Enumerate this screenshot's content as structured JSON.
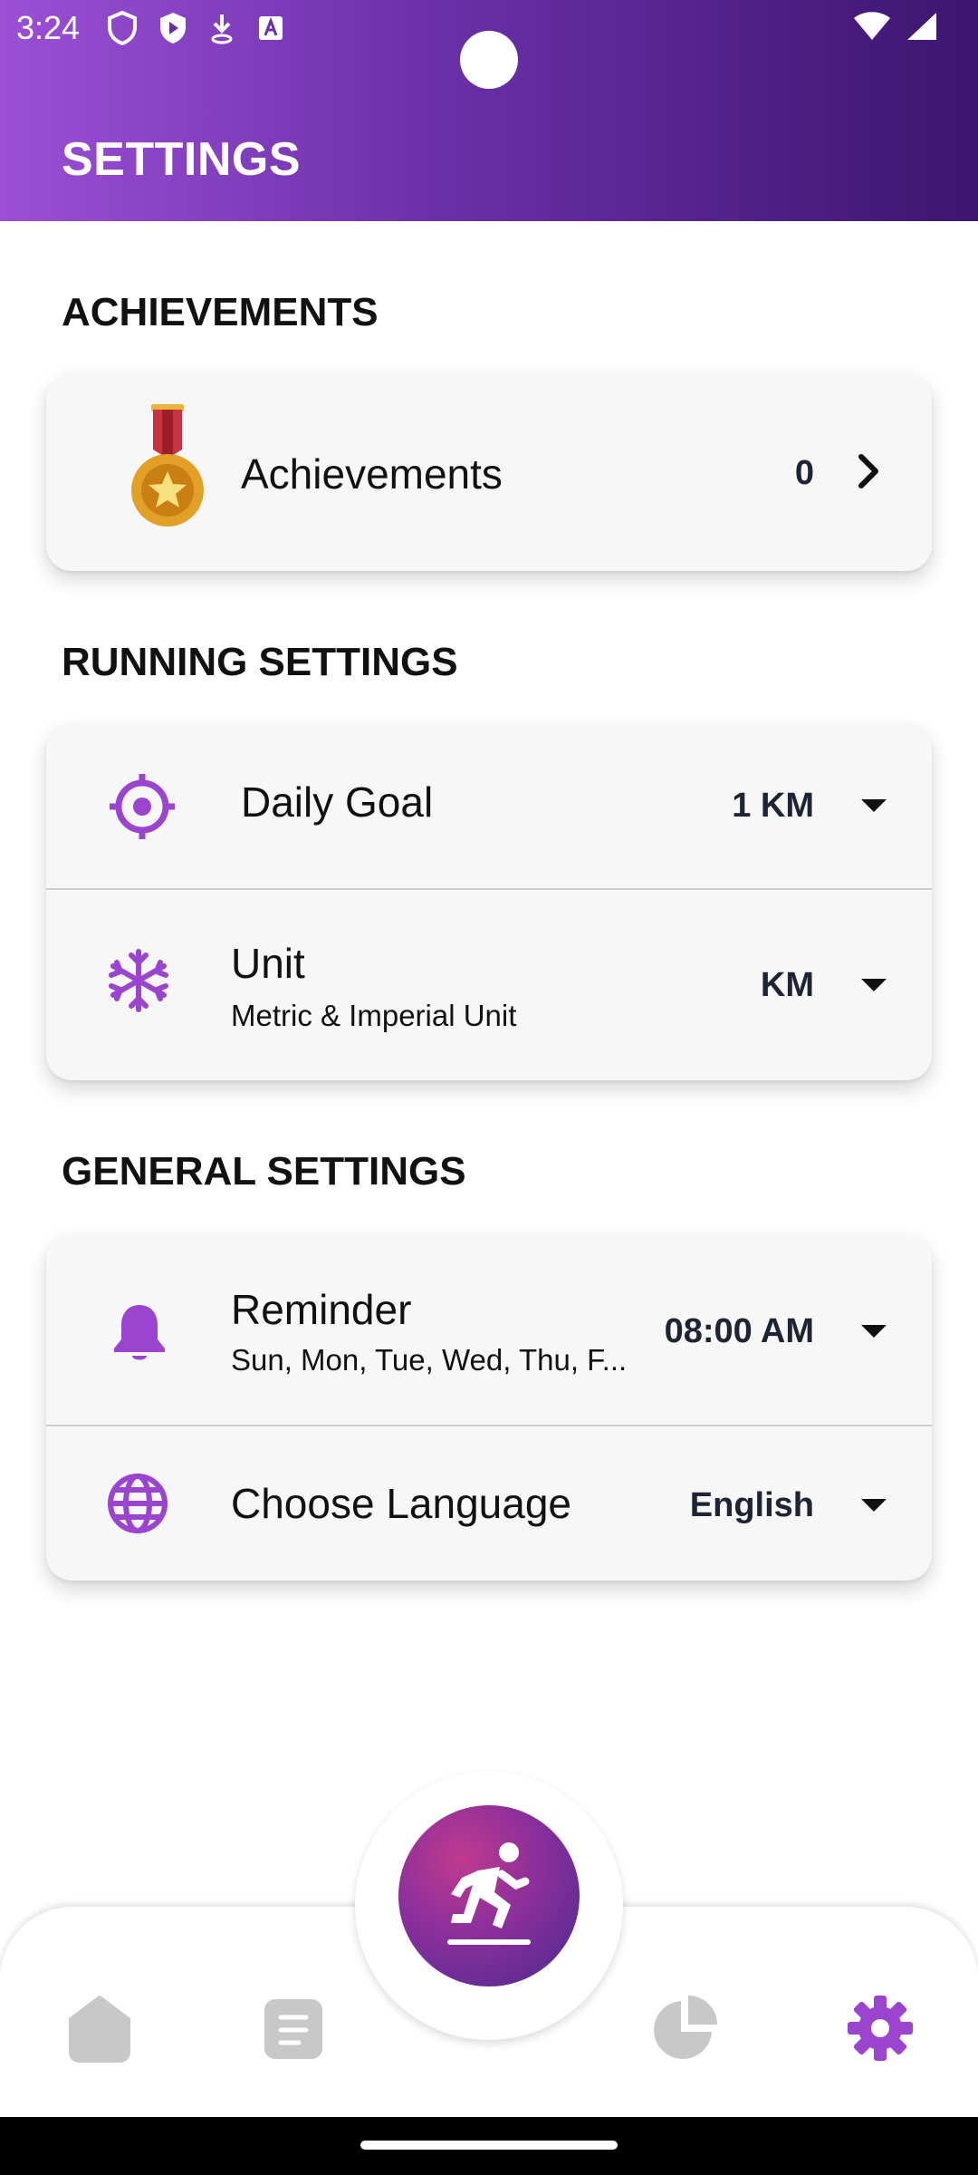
{
  "status_bar": {
    "time": "3:24"
  },
  "header": {
    "title": "SETTINGS"
  },
  "sections": {
    "achievements": {
      "title": "ACHIEVEMENTS",
      "item": {
        "label": "Achievements",
        "value": "0"
      }
    },
    "running": {
      "title": "RUNNING SETTINGS",
      "daily_goal": {
        "label": "Daily Goal",
        "value": "1 KM"
      },
      "unit": {
        "label": "Unit",
        "sublabel": "Metric & Imperial Unit",
        "value": "KM"
      }
    },
    "general": {
      "title": "GENERAL SETTINGS",
      "reminder": {
        "label": "Reminder",
        "sublabel": "Sun, Mon, Tue, Wed, Thu, F...",
        "value": "08:00 AM"
      },
      "language": {
        "label": "Choose Language",
        "value": "English"
      }
    }
  },
  "bottom_nav": {
    "items": [
      "home-icon",
      "journal-icon",
      "run-icon",
      "stats-icon",
      "settings-icon"
    ],
    "active": "settings-icon"
  },
  "colors": {
    "accent": "#9a44cf",
    "header_start": "#9c4fd6",
    "header_end": "#3d1570",
    "inactive_icon": "#c8c8c8"
  }
}
